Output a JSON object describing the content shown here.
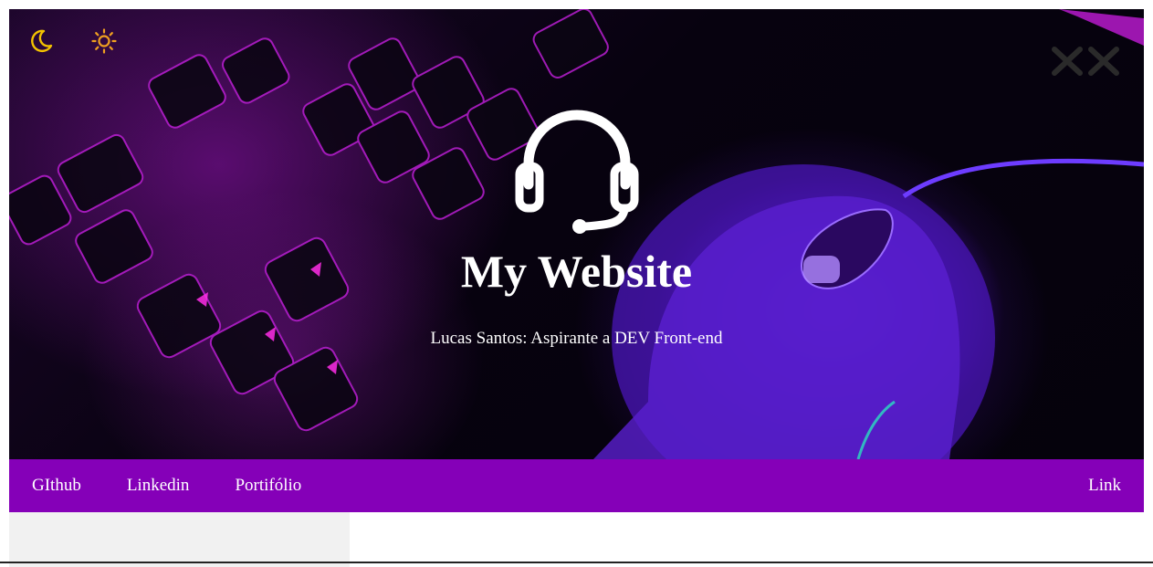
{
  "header": {
    "title": "My Website",
    "subtitle": "Lucas Santos: Aspirante a DEV Front-end"
  },
  "theme_toggle": {
    "dark_icon": "moon-icon",
    "light_icon": "sun-icon",
    "dark_color": "#f2c200",
    "light_color": "#f0a020"
  },
  "hero_icons": {
    "center_icon": "headset-icon",
    "close_icon": "close-icon"
  },
  "nav": {
    "items": [
      {
        "label": "GIthub"
      },
      {
        "label": "Linkedin"
      },
      {
        "label": "Portifólio"
      }
    ],
    "right_link": "Link"
  },
  "colors": {
    "nav_background": "#8500b8",
    "sidebar_background": "#f1f1f1",
    "hero_accent": "#c21bd8"
  }
}
